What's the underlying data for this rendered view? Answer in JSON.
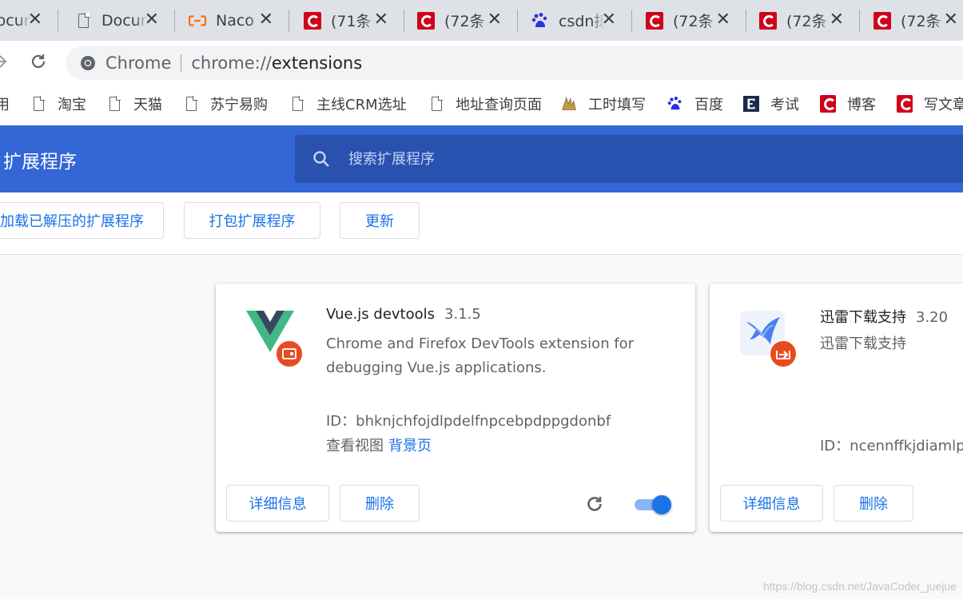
{
  "tabs": [
    {
      "title": "Docum",
      "icon": "document-icon"
    },
    {
      "title": "Docum",
      "icon": "document-icon"
    },
    {
      "title": "Naco",
      "icon": "aliyun-icon"
    },
    {
      "title": "(71条",
      "icon": "csdn-icon"
    },
    {
      "title": "(72条",
      "icon": "csdn-icon"
    },
    {
      "title": "csdn掠",
      "icon": "baidu-icon"
    },
    {
      "title": "(72条",
      "icon": "csdn-icon"
    },
    {
      "title": "(72条",
      "icon": "csdn-icon"
    },
    {
      "title": "(72条",
      "icon": "csdn-icon"
    }
  ],
  "omnibox": {
    "scheme_label": "Chrome",
    "url_scheme": "chrome://",
    "url_host": "extensions"
  },
  "bookmarks": [
    {
      "label": "用",
      "icon": "none"
    },
    {
      "label": "淘宝",
      "icon": "document-icon"
    },
    {
      "label": "天猫",
      "icon": "document-icon"
    },
    {
      "label": "苏宁易购",
      "icon": "document-icon"
    },
    {
      "label": "主线CRM选址",
      "icon": "document-icon"
    },
    {
      "label": "地址查询页面",
      "icon": "document-icon"
    },
    {
      "label": "工时填写",
      "icon": "timesheet-icon"
    },
    {
      "label": "百度",
      "icon": "baidu-icon"
    },
    {
      "label": "考试",
      "icon": "exam-icon"
    },
    {
      "label": "博客",
      "icon": "csdn-icon"
    },
    {
      "label": "写文章",
      "icon": "csdn-icon"
    }
  ],
  "header": {
    "title": "扩展程序",
    "search_placeholder": "搜索扩展程序"
  },
  "dev_toolbar": {
    "load_unpacked": "加载已解压的扩展程序",
    "pack": "打包扩展程序",
    "update": "更新"
  },
  "extensions": [
    {
      "name": "Vue.js devtools",
      "version": "3.1.5",
      "description": "Chrome and Firefox DevTools extension for debugging Vue.js applications.",
      "id_label": "ID：",
      "id": "bhknjchfojdlpdelfnpcebpdppgdonbf",
      "inspect_label": "查看视图",
      "inspect_link": "背景页",
      "details": "详细信息",
      "remove": "删除",
      "enabled": true
    },
    {
      "name": "迅雷下载支持",
      "version": "3.20",
      "description": "迅雷下载支持",
      "id_label": "ID：",
      "id": "ncennffkjdiamlp",
      "details": "详细信息",
      "remove": "删除"
    }
  ],
  "watermark": "https://blog.csdn.net/JavaCoder_juejue",
  "colors": {
    "header_blue": "#3367d6",
    "search_blue": "#2851b0",
    "link_blue": "#1a73e8",
    "badge_orange": "#ea4a1f"
  }
}
